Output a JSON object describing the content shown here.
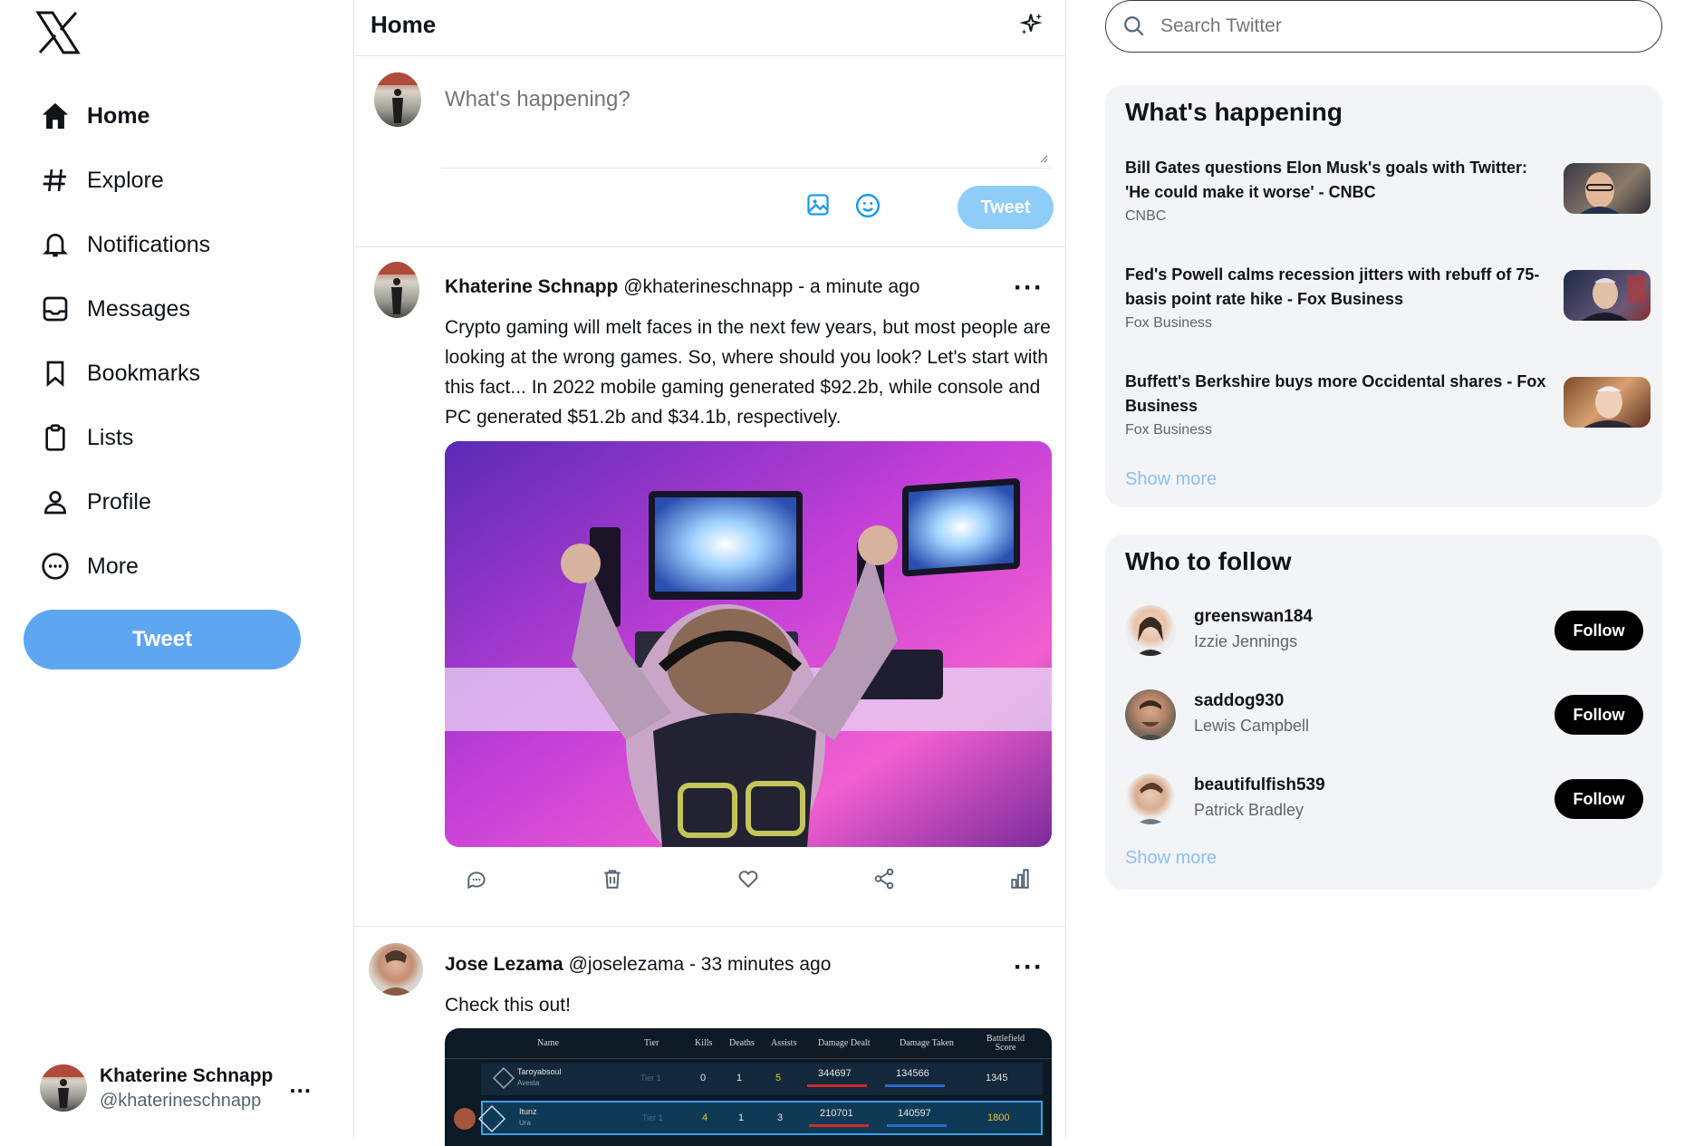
{
  "nav": {
    "items": [
      {
        "label": "Home",
        "icon": "home-icon"
      },
      {
        "label": "Explore",
        "icon": "hashtag-icon"
      },
      {
        "label": "Notifications",
        "icon": "bell-icon"
      },
      {
        "label": "Messages",
        "icon": "inbox-icon"
      },
      {
        "label": "Bookmarks",
        "icon": "bookmark-icon"
      },
      {
        "label": "Lists",
        "icon": "clipboard-icon"
      },
      {
        "label": "Profile",
        "icon": "user-icon"
      },
      {
        "label": "More",
        "icon": "more-circle-icon"
      }
    ],
    "tweet_button": "Tweet"
  },
  "account": {
    "name": "Khaterine Schnapp",
    "handle": "@khaterineschnapp",
    "menu": "..."
  },
  "header": {
    "title": "Home"
  },
  "composer": {
    "placeholder": "What's happening?",
    "tweet_button": "Tweet"
  },
  "feed": [
    {
      "name": "Khaterine Schnapp",
      "handle": "@khaterineschnapp",
      "time": "- a minute ago",
      "text": "Crypto gaming will melt faces in the next few years, but most people are looking at the wrong games. So, where should you look? Let's start with this fact... In 2022 mobile gaming generated $92.2b, while console and PC generated $51.2b and $34.1b, respectively."
    },
    {
      "name": "Jose Lezama",
      "handle": "@joselezama",
      "time": "- 33 minutes ago",
      "text": "Check this out!",
      "scoreboard": {
        "headers": [
          "Name",
          "Tier",
          "Kills",
          "Deaths",
          "Assists",
          "Damage Dealt",
          "Damage Taken",
          "Battlefield Score"
        ],
        "rows": [
          [
            "Taroyabsoul",
            "Tier 1",
            "0",
            "1",
            "5",
            "344697",
            "134566",
            "1345"
          ],
          [
            "Itunz",
            "Tier 1",
            "4",
            "1",
            "3",
            "210701",
            "140597",
            "1800"
          ]
        ],
        "row_subs": [
          "Avesta",
          "Ura"
        ]
      }
    }
  ],
  "search": {
    "placeholder": "Search Twitter"
  },
  "trends": {
    "title": "What's happening",
    "items": [
      {
        "title": "Bill Gates questions Elon Musk's goals with Twitter: 'He could make it worse' - CNBC",
        "source": "CNBC"
      },
      {
        "title": "Fed's Powell calms recession jitters with rebuff of 75-basis point rate hike - Fox Business",
        "source": "Fox Business"
      },
      {
        "title": "Buffett's Berkshire buys more Occidental shares - Fox Business",
        "source": "Fox Business"
      }
    ],
    "show_more": "Show more"
  },
  "who_to_follow": {
    "title": "Who to follow",
    "items": [
      {
        "username": "greenswan184",
        "name": "Izzie Jennings",
        "button": "Follow"
      },
      {
        "username": "saddog930",
        "name": "Lewis Campbell",
        "button": "Follow"
      },
      {
        "username": "beautifulfish539",
        "name": "Patrick Bradley",
        "button": "Follow"
      }
    ],
    "show_more": "Show more"
  },
  "colors": {
    "accent": "#1d9bf0",
    "tweet_button": "#5fa6f2",
    "tweet_disabled": "#8ecdf8",
    "card_bg": "#f3f4f6",
    "link_muted": "#8fbff0"
  }
}
